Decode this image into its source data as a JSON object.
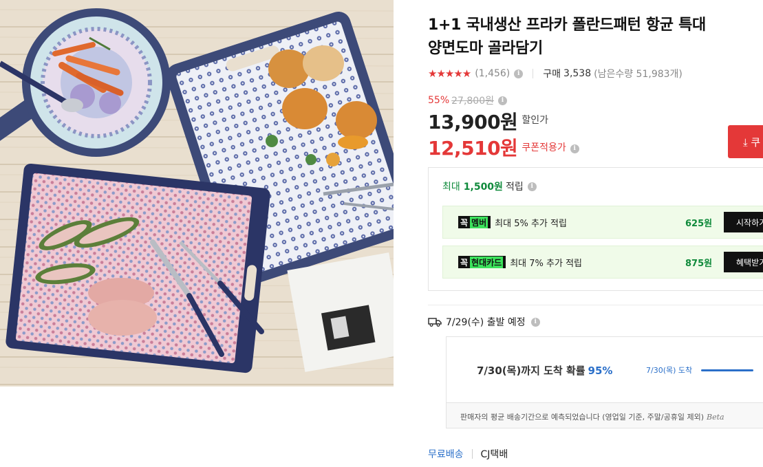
{
  "product": {
    "title_line1": "1+1 국내생산 프라카 폴란드패턴 항균 특대",
    "title_line2": "양면도마 골라담기",
    "stars": "★★★★★",
    "rating": 4.5,
    "review_count": "(1,456)",
    "purchase_label": "구매",
    "purchase_count": "3,538",
    "remaining": "(남은수량 51,983개)"
  },
  "price": {
    "discount_rate": "55%",
    "original_price": "27,800원",
    "sale_price": "13,900원",
    "sale_label": "할인가",
    "coupon_price": "12,510원",
    "coupon_label": "쿠폰적용가",
    "coupon_button_label": "⤓ 쿠"
  },
  "reward": {
    "head_prefix": "최대",
    "head_amount": "1,500원",
    "head_suffix": "적립",
    "items": [
      {
        "badge_prefix": "꼭",
        "badge_hl": "멤버",
        "text": "최대 5% 추가 적립",
        "amount": "625원",
        "action": "시작하기"
      },
      {
        "badge_prefix": "꼭",
        "badge_hl": "현대카드",
        "text": "최대 7% 추가 적립",
        "amount": "875원",
        "action": "혜택받기"
      }
    ]
  },
  "shipping": {
    "departure": "7/29(수) 출발 예정",
    "arrival_main": "7/30(목)까지 도착 확률",
    "arrival_pct": "95%",
    "arrival_small": "7/30(목) 도착",
    "note": "판매자의 평균 배송기간으로 예측되었습니다 (영업일 기준, 주말/공휴일 제외)",
    "beta": "Beta",
    "free_shipping": "무료배송",
    "courier": "CJ택배"
  },
  "icons": {
    "info": "info-icon",
    "truck": "truck-icon",
    "download": "download-icon"
  },
  "colors": {
    "accent_red": "#e43838",
    "reward_green": "#0f8a3b",
    "link_blue": "#2a6fc9"
  }
}
